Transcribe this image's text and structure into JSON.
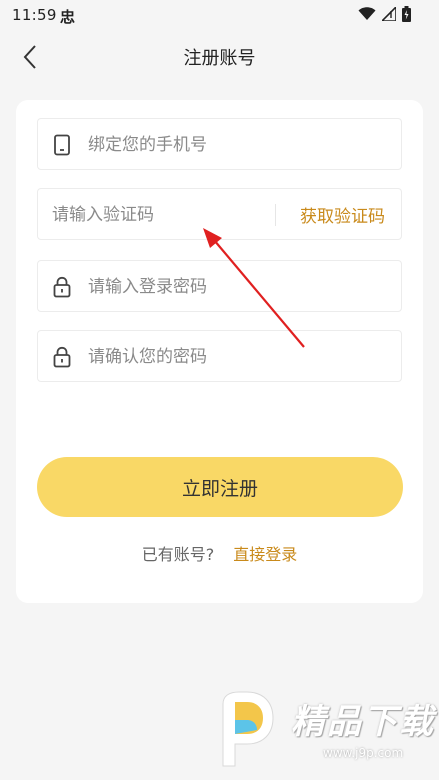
{
  "status_bar": {
    "time": "11:59",
    "app_glyph": "忠",
    "icons": [
      "wifi-icon",
      "signal-icon",
      "battery-icon"
    ]
  },
  "nav": {
    "title": "注册账号",
    "back_icon": "chevron-left-icon"
  },
  "form": {
    "phone_placeholder": "绑定您的手机号",
    "code_placeholder": "请输入验证码",
    "get_code_label": "获取验证码",
    "password_placeholder": "请输入登录密码",
    "confirm_password_placeholder": "请确认您的密码"
  },
  "actions": {
    "register_label": "立即注册",
    "login_prompt": "已有账号?",
    "login_link": "直接登录"
  },
  "colors": {
    "accent": "#c98a1b",
    "button": "#f9d866",
    "annotation": "#e02020"
  },
  "watermark": {
    "text": "精品下载",
    "url": "www.j9p.com"
  }
}
